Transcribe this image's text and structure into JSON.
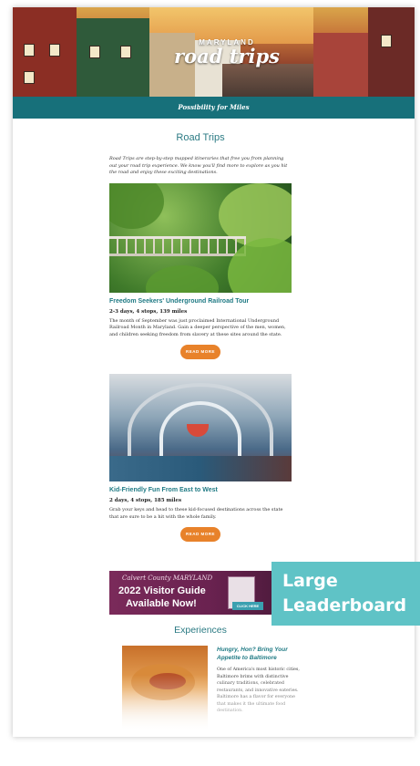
{
  "hero": {
    "kicker": "MARYLAND",
    "title": "road trips",
    "tagline": "Possibility for Miles"
  },
  "road_trips": {
    "section_title": "Road Trips",
    "intro": "Road Trips are step-by-step mapped itineraries that free you from planning out your road trip experience. We know you'll find more to explore as you hit the road and enjoy these exciting destinations.",
    "cards": [
      {
        "title": "Freedom Seekers' Underground Railroad Tour",
        "meta": "2-3 days, 4 stops, 139 miles",
        "description": "The month of September was just proclaimed International Underground Railroad Month in Maryland. Gain a deeper perspective of the men, women, and children seeking freedom from slavery at these sites around the state.",
        "button": "READ MORE"
      },
      {
        "title": "Kid-Friendly Fun From East to West",
        "meta": "2 days, 4 stops, 185 miles",
        "description": "Grab your keys and head to these kid-focused destinations across the state that are sure to be a hit with the whole family.",
        "button": "READ MORE"
      }
    ]
  },
  "ad": {
    "brand": "Calvert County MARYLAND",
    "line1": "2022 Visitor Guide",
    "line2": "Available Now!",
    "cta": "CLICK HERE"
  },
  "leaderboard": {
    "line1": "Large",
    "line2": "Leaderboard"
  },
  "experiences": {
    "section_title": "Experiences",
    "headline": "Hungry, Hon? Bring Your Appetite to Baltimore",
    "description": "One of America's most historic cities, Baltimore brims with distinctive culinary traditions, celebrated restaurants, and innovative eateries. Baltimore has a flavor for everyone that makes it the ultimate food destination."
  },
  "colors": {
    "teal": "#17707a",
    "accent_orange": "#e8822a",
    "leaderboard_bg": "#5fc3c6",
    "ad_purple": "#7a2a5a"
  }
}
